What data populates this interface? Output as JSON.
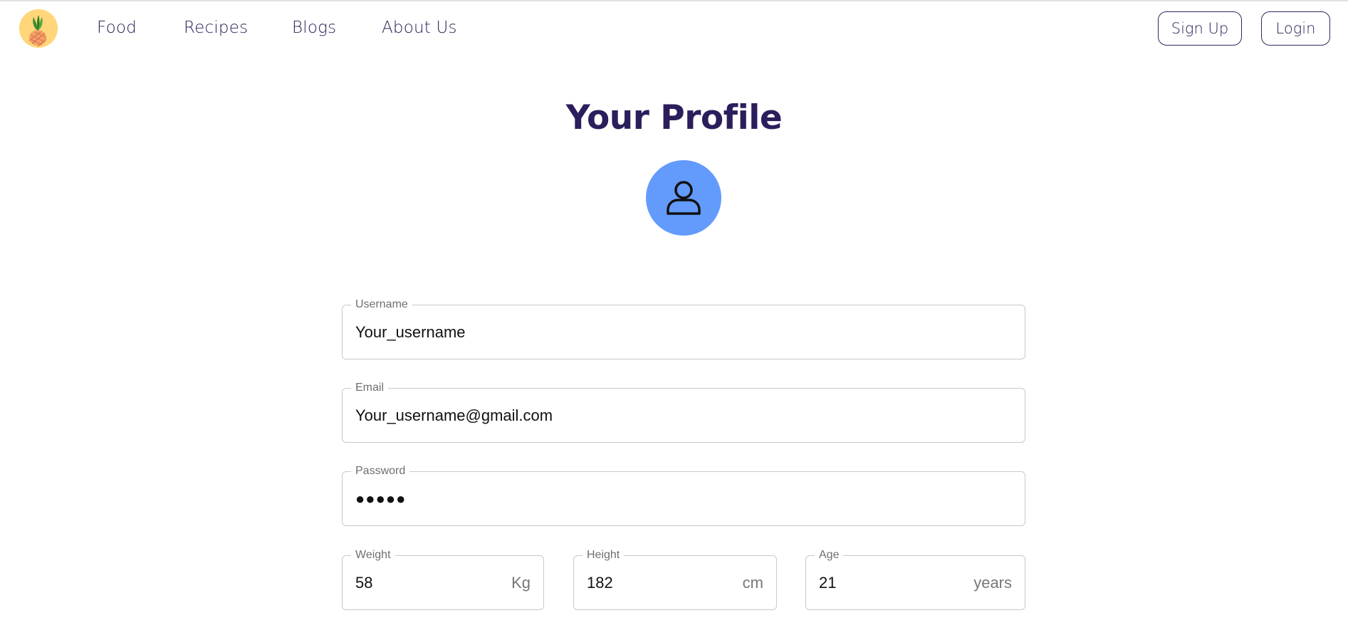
{
  "nav": {
    "links": [
      "Food",
      "Recipes",
      "Blogs",
      "About Us"
    ],
    "signup_label": "Sign Up",
    "login_label": "Login"
  },
  "page": {
    "title": "Your Profile"
  },
  "form": {
    "username": {
      "label": "Username",
      "value": "Your_username"
    },
    "email": {
      "label": "Email",
      "value": "Your_username@gmail.com"
    },
    "password": {
      "label": "Password",
      "value": "●●●●●"
    },
    "weight": {
      "label": "Weight",
      "value": "58",
      "unit": "Kg"
    },
    "height": {
      "label": "Height",
      "value": "182",
      "unit": "cm"
    },
    "age": {
      "label": "Age",
      "value": "21",
      "unit": "years"
    }
  },
  "colors": {
    "brand_text": "#2c1d5c",
    "avatar_bg": "#639bfd",
    "logo_bg": "#ffd67a"
  },
  "icons": {
    "logo": "pineapple-logo-icon",
    "avatar": "user-icon"
  }
}
